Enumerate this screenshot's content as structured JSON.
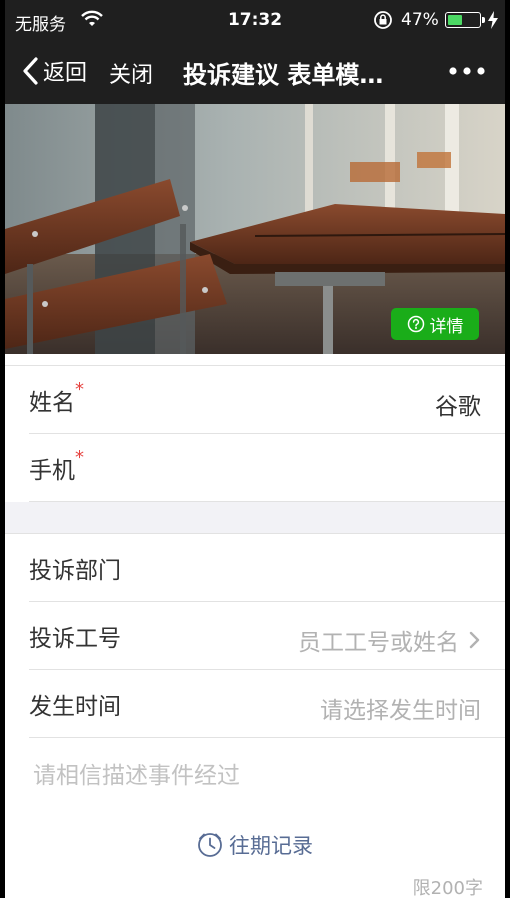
{
  "status_bar": {
    "carrier": "无服务",
    "time": "17:32",
    "battery_percent": "47%",
    "battery_level": 0.47,
    "battery_color": "#4cd964"
  },
  "nav": {
    "back_label": "返回",
    "close_label": "关闭",
    "title": "投诉建议 表单模…",
    "more_icon": "more-dots-icon"
  },
  "banner": {
    "detail_label": "详情",
    "detail_icon": "question-circle-icon",
    "detail_color": "#1aad19"
  },
  "form": {
    "name_label": "姓名",
    "name_required": "*",
    "name_value": "谷歌",
    "phone_label": "手机",
    "phone_required": "*",
    "dept_label": "投诉部门",
    "staff_label": "投诉工号",
    "staff_placeholder": "员工工号或姓名",
    "time_label": "发生时间",
    "time_placeholder": "请选择发生时间",
    "description_placeholder": "请相信描述事件经过",
    "history_label": "往期记录",
    "char_limit": "限200字",
    "required_color": "#e64340",
    "link_color": "#586c94"
  }
}
